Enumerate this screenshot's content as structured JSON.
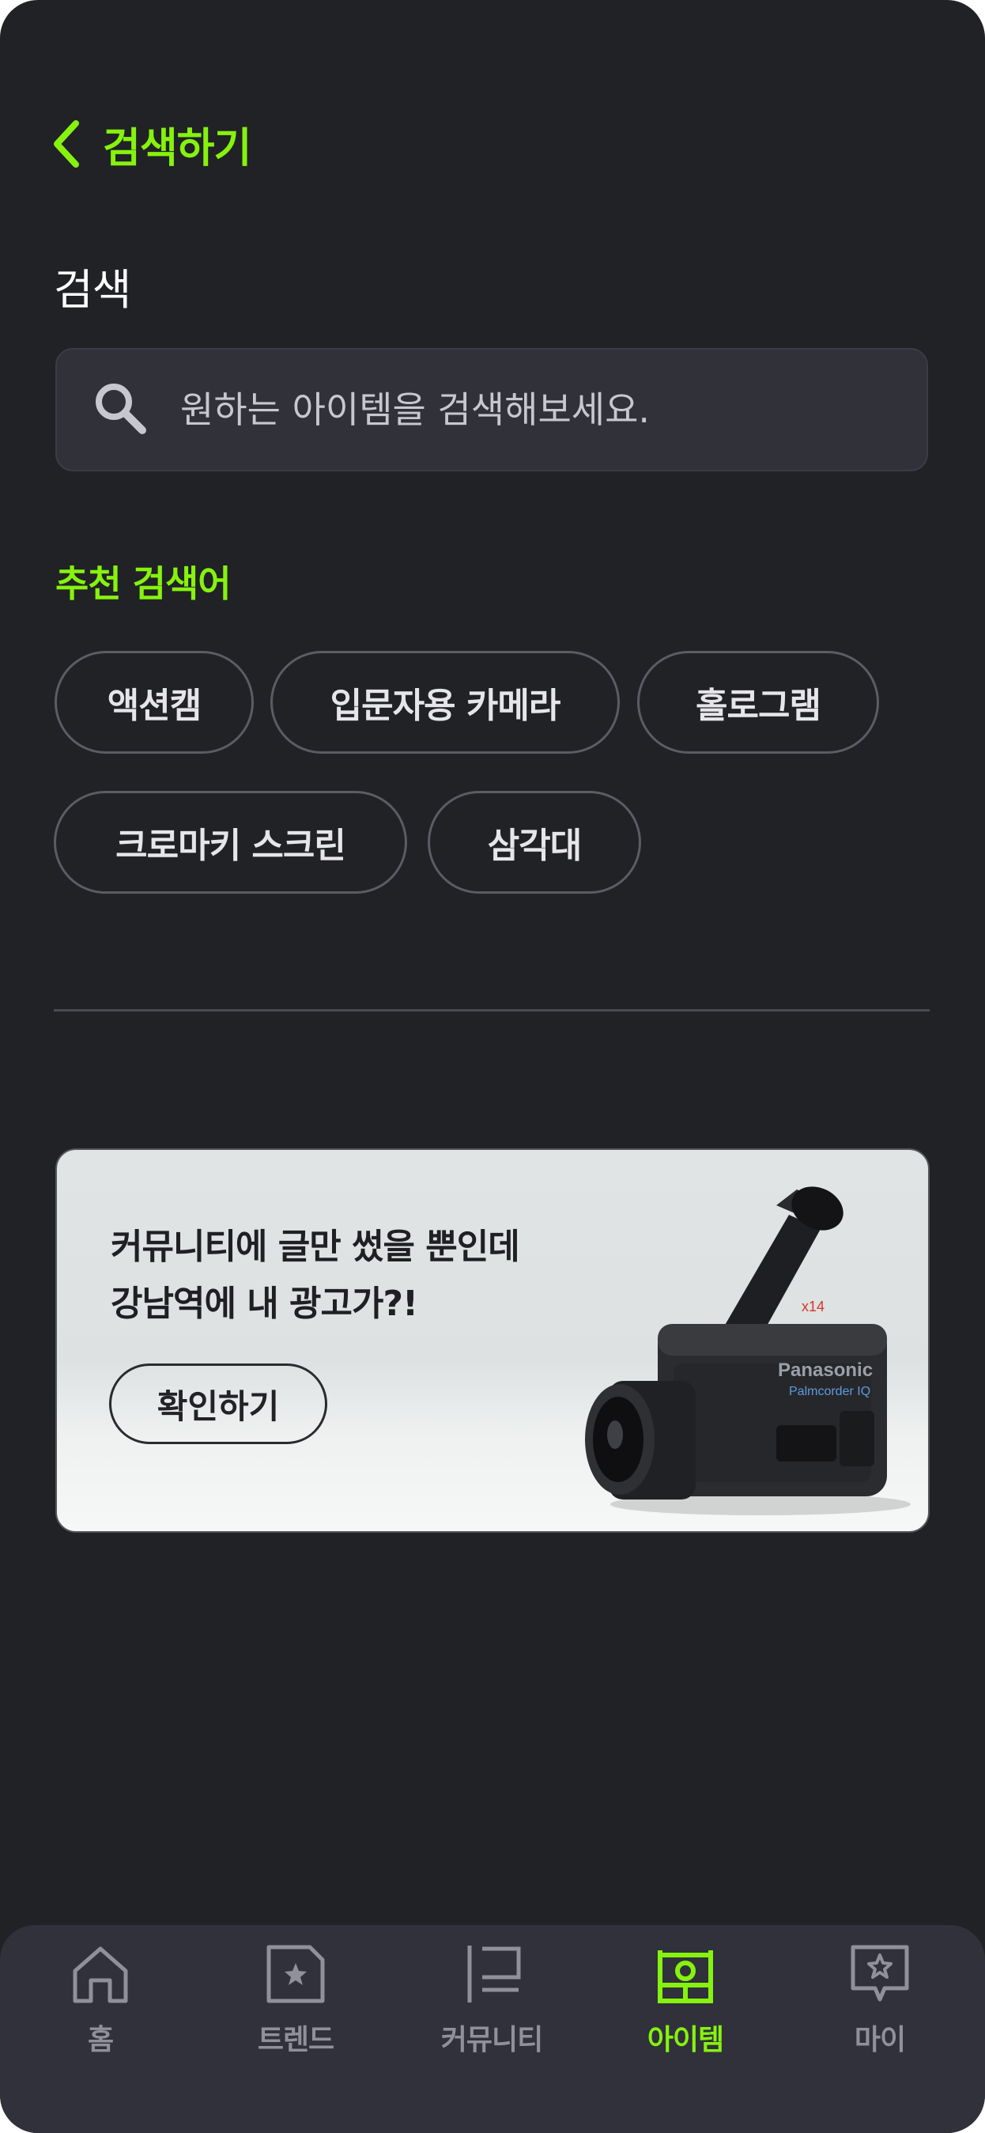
{
  "header": {
    "title": "검색하기",
    "back_icon": "chevron-left-icon"
  },
  "search": {
    "section_label": "검색",
    "placeholder": "원하는 아이템을 검색해보세요.",
    "value": "",
    "icon": "search-icon"
  },
  "recommended": {
    "title": "추천 검색어",
    "chips": [
      "액션캠",
      "입문자용 카메라",
      "홀로그램",
      "크로마키 스크린",
      "삼각대"
    ]
  },
  "banner": {
    "line1": "커뮤니티에 글만 썼을 뿐인데",
    "line2": "강남역에 내 광고가?!",
    "cta": "확인하기",
    "camera_brand": "Panasonic",
    "camera_model": "Palmcorder IQ",
    "camera_zoom": "x14"
  },
  "tabbar": {
    "tabs": [
      {
        "label": "홈",
        "icon": "home-icon",
        "active": false
      },
      {
        "label": "트렌드",
        "icon": "trend-icon",
        "active": false
      },
      {
        "label": "커뮤니티",
        "icon": "community-icon",
        "active": false
      },
      {
        "label": "아이템",
        "icon": "item-icon",
        "active": true
      },
      {
        "label": "마이",
        "icon": "my-icon",
        "active": false
      }
    ]
  },
  "colors": {
    "accent": "#86f20e",
    "background": "#212226",
    "surface": "#303139",
    "tabbar": "#30313b",
    "inactive": "#8f9099"
  }
}
